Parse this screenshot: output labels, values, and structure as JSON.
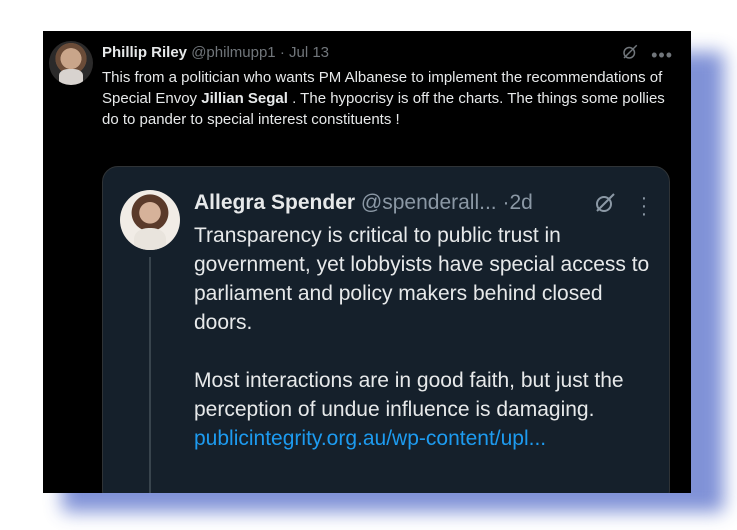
{
  "tweet": {
    "author_name": "Phillip Riley",
    "handle": "@philmupp1",
    "separator": "·",
    "timestamp": "Jul 13",
    "text_part1": "This from a politician who wants PM Albanese to implement the recommendations of Special Envoy ",
    "text_bold": "Jillian Segal",
    "text_part2": " . The hypocrisy is off the charts. The things some pollies do to pander to special interest constituents !"
  },
  "quoted_tweet": {
    "author_name": "Allegra Spender",
    "handle": "@spenderall...",
    "separator": "·",
    "timestamp": "2d",
    "paragraph1": "Transparency is critical to public trust in government, yet lobbyists have special access to parliament and policy makers behind closed doors.",
    "paragraph2": "Most interactions are in good faith, but just the perception of undue influence is damaging.",
    "link": "publicintegrity.org.au/wp-content/upl..."
  },
  "icons": {
    "grok": "grok-icon",
    "more_horizontal": "more-horizontal-icon",
    "more_vertical": "more-vertical-icon"
  },
  "colors": {
    "background": "#000000",
    "quote_background": "#15202b",
    "text": "#e7e9ea",
    "secondary_text": "#71767b",
    "link": "#1d9bf0",
    "frame_shadow": "#6a7fd0"
  }
}
